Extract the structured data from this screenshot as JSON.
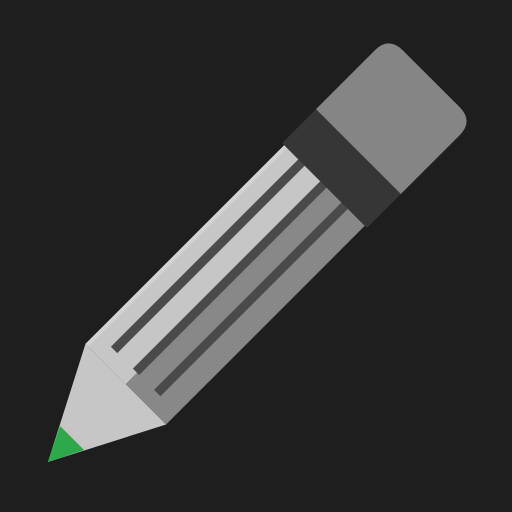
{
  "icon": {
    "name": "pencil-icon",
    "colors": {
      "background": "#1e1e1e",
      "eraser": "#858585",
      "ferrule": "#363636",
      "body_light": "#c6c6c6",
      "body_mid": "#888888",
      "body_stripe": "#4a4a4a",
      "wood_tip": "#c6c6c6",
      "lead_tip": "#2ea84a"
    }
  }
}
